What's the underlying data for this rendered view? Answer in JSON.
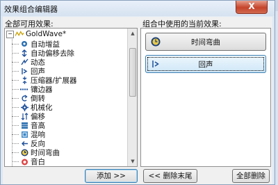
{
  "window": {
    "title": "效果组合编辑器",
    "close_label": "X"
  },
  "left_panel": {
    "label": "全部可用效果:",
    "root": {
      "label": "GoldWave*",
      "icon": "goldwave-icon"
    },
    "items": [
      {
        "label": "自动增益",
        "icon": "auto-gain-icon"
      },
      {
        "label": "自动偏移去除",
        "icon": "dc-offset-icon"
      },
      {
        "label": "动态",
        "icon": "dynamics-icon"
      },
      {
        "label": "回声",
        "icon": "echo-icon"
      },
      {
        "label": "压缩器/扩展器",
        "icon": "compressor-icon"
      },
      {
        "label": "镶边器",
        "icon": "flanger-icon"
      },
      {
        "label": "倒转",
        "icon": "invert-icon"
      },
      {
        "label": "机械化",
        "icon": "mechanize-icon"
      },
      {
        "label": "偏移",
        "icon": "offset-icon"
      },
      {
        "label": "音高",
        "icon": "pitch-icon"
      },
      {
        "label": "混响",
        "icon": "reverb-icon"
      },
      {
        "label": "反向",
        "icon": "reverse-icon"
      },
      {
        "label": "时间弯曲",
        "icon": "time-warp-icon"
      },
      {
        "label": "音白",
        "icon": "volume-icon"
      }
    ]
  },
  "right_panel": {
    "label": "组合中使用的当前效果:",
    "effects": [
      {
        "label": "时间弯曲",
        "icon": "time-warp-icon",
        "selected": false
      },
      {
        "label": "回声",
        "icon": "echo-icon",
        "selected": true
      }
    ]
  },
  "buttons": {
    "add": "添加 >>",
    "remove_last": "<< 删除末尾",
    "remove_all": "全部删除"
  }
}
